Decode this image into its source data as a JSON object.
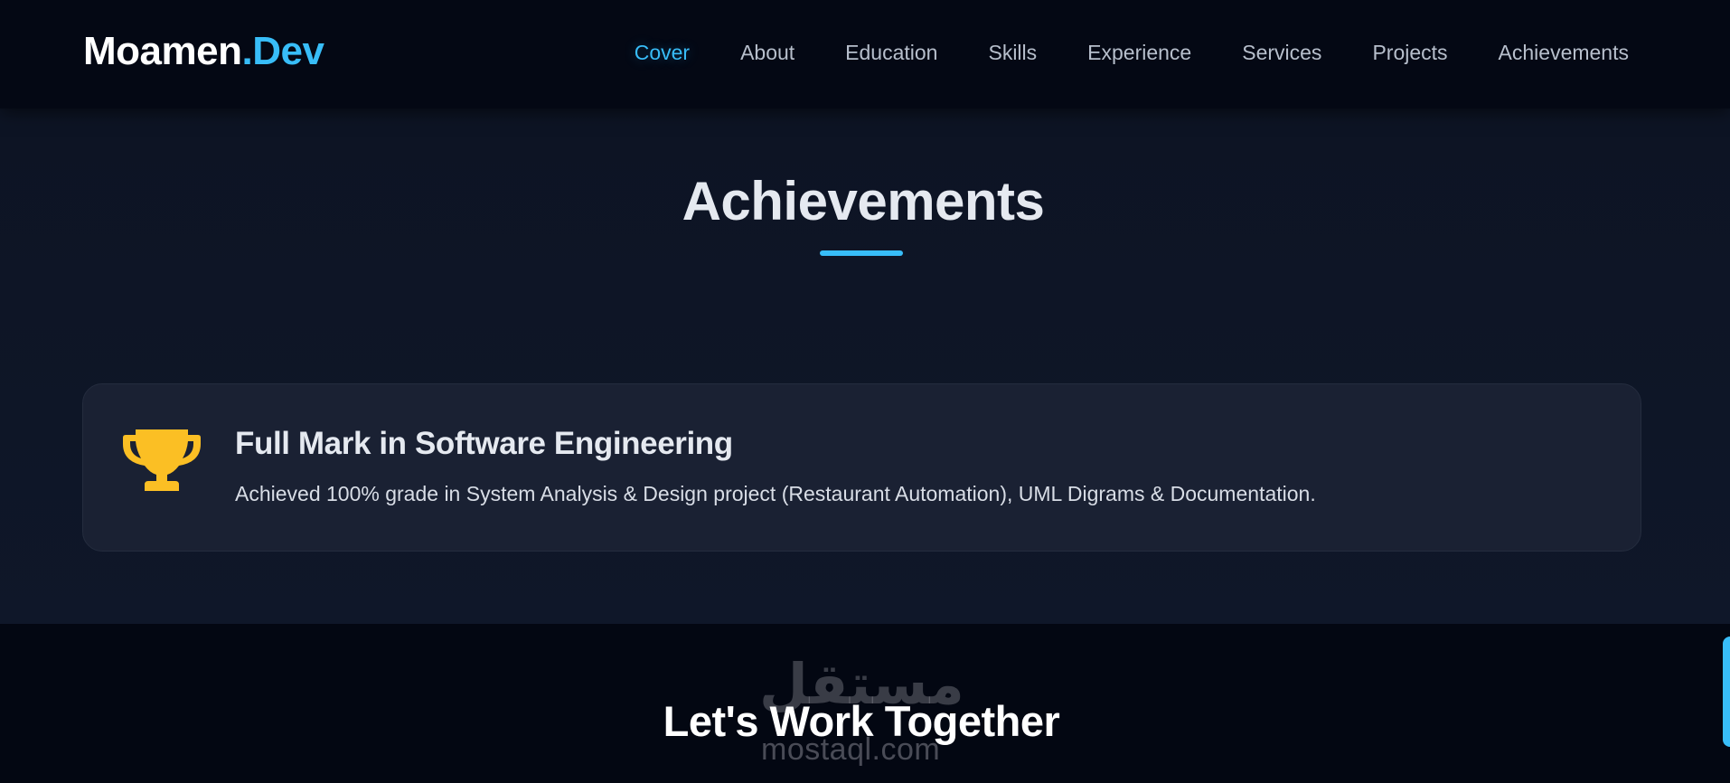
{
  "navbar": {
    "logo_main": "Moamen",
    "logo_accent": ".Dev",
    "links": [
      {
        "label": "Cover",
        "active": true
      },
      {
        "label": "About",
        "active": false
      },
      {
        "label": "Education",
        "active": false
      },
      {
        "label": "Skills",
        "active": false
      },
      {
        "label": "Experience",
        "active": false
      },
      {
        "label": "Services",
        "active": false
      },
      {
        "label": "Projects",
        "active": false
      },
      {
        "label": "Achievements",
        "active": false
      }
    ]
  },
  "achievements": {
    "title": "Achievements",
    "items": [
      {
        "icon": "trophy-icon",
        "title": "Full Mark in Software Engineering",
        "description": "Achieved 100% grade in System Analysis & Design project (Restaurant Automation), UML Digrams & Documentation."
      }
    ]
  },
  "cta": {
    "title": "Let's Work Together"
  },
  "watermark": {
    "arabic": "مستقل",
    "latin": "mostaql.com"
  },
  "colors": {
    "accent": "#38bdf8",
    "trophy": "#fbbf24",
    "background": "#030712",
    "card": "#1a2133"
  }
}
